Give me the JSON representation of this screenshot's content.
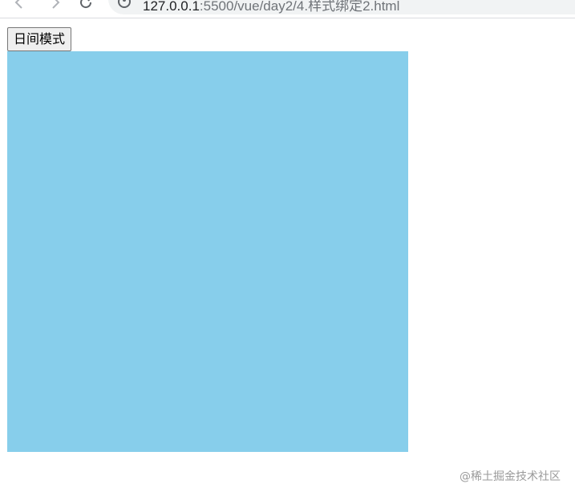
{
  "browser": {
    "url_host": "127.0.0.1",
    "url_path": ":5500/vue/day2/4.样式绑定2.html",
    "icons": {
      "back": "arrow-left-icon",
      "forward": "arrow-right-icon",
      "reload": "reload-icon",
      "info": "info-icon"
    }
  },
  "page": {
    "mode_button_label": "日间模式",
    "box_color": "#87ceeb"
  },
  "watermark": {
    "text": "@稀土掘金技术社区"
  }
}
